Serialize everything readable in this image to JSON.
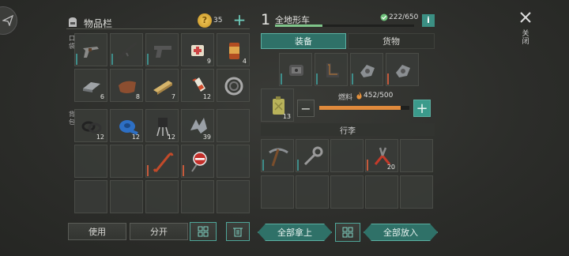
{
  "inventory": {
    "title": "物品栏",
    "coins": "35",
    "pockets_label": "口袋",
    "backpack_label": "背包",
    "pocket_counts": [
      "",
      "",
      "",
      "9",
      "4",
      "6",
      "8",
      "7",
      "12",
      ""
    ],
    "backpack_counts": [
      "12",
      "12",
      "12",
      "39",
      "",
      "",
      "",
      "",
      "",
      "",
      "",
      "",
      "",
      "",
      ""
    ],
    "use_label": "使用",
    "split_label": "分开"
  },
  "vehicle": {
    "index": "1",
    "name": "全地形车",
    "durability": "222/650",
    "info_label": "i",
    "tab_equipment": "装备",
    "tab_cargo": "货物",
    "fuel_label": "燃料",
    "fuel_value": "452/500",
    "fuel_fraction": 0.904,
    "durability_fraction": 0.342,
    "fuel_can_count": "13",
    "luggage_label": "行李",
    "luggage_counts": [
      "",
      "",
      "",
      "20",
      "",
      "",
      "",
      "",
      "",
      ""
    ],
    "take_all_label": "全部拿上",
    "put_all_label": "全部放入",
    "close_label": "关闭"
  },
  "colors": {
    "accent_teal": "#2f7168",
    "quality_red": "#c65a3c",
    "quality_teal": "#3f8d8a"
  }
}
